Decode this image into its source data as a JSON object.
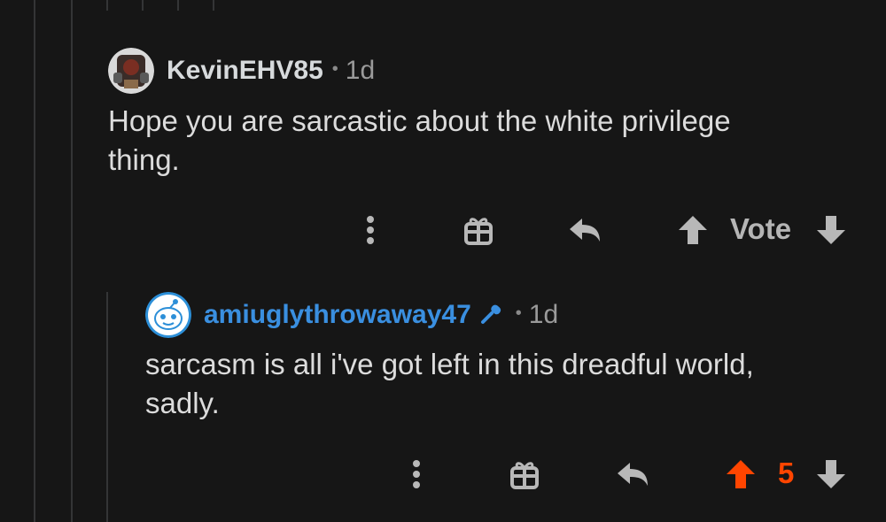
{
  "comments": [
    {
      "username": "KevinEHV85",
      "separator": "•",
      "age": "1d",
      "body": "Hope you are sarcastic about the white privilege\nthing.",
      "vote_label": "Vote",
      "username_color": "#d7dadc"
    },
    {
      "username": "amiuglythrowaway47",
      "separator": "•",
      "age": "1d",
      "body": "sarcasm is all i've got left in this dreadful world,\nsadly.",
      "score": "5",
      "username_color": "#3a8fe0",
      "flair_icon": "microphone-icon"
    }
  ],
  "colors": {
    "background": "#161616",
    "thread_line": "#343536",
    "upvote_active": "#ff4500",
    "icon": "#b8b8b8"
  },
  "icons": [
    "more-options-icon",
    "gift-icon",
    "reply-icon",
    "upvote-arrow-icon",
    "downvote-arrow-icon"
  ]
}
